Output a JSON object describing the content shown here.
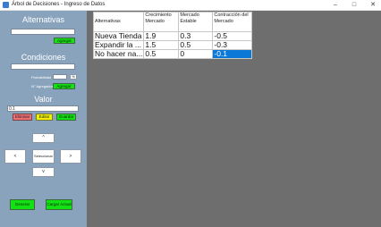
{
  "window": {
    "title": "Árbol de Decisiones - Ingreso de Datos",
    "minimize": "–",
    "maximize": "□",
    "close": "✕"
  },
  "sidebar": {
    "alternativas": {
      "title": "Alternativas",
      "input_value": "",
      "add_label": "Agregar"
    },
    "condiciones": {
      "title": "Condiciones",
      "input_value": "",
      "probabilidad_label": "Probabilidad",
      "probabilidad_value": "",
      "percent_label": "%",
      "agregar_label": "N° Agregados",
      "add_label": "Agregar"
    },
    "valor": {
      "title": "Valor",
      "input_value": "0.1",
      "eliminar_label": "Eliminar",
      "editar_label": "Editar",
      "guardar_label": "Guardar"
    },
    "nav": {
      "up": "^",
      "down": "v",
      "left": "<",
      "right": ">",
      "center": "Seleccionar"
    },
    "bottom": {
      "generar_label": "Generar",
      "cargar_label": "Cargar Actual"
    }
  },
  "table": {
    "headers": [
      "Alternativas",
      "Crecimiento Mercado",
      "Mercado Estable",
      "Contracción del Mercado"
    ],
    "rows": [
      [
        "Nueva Tienda",
        "1.9",
        "0.3",
        "-0.5"
      ],
      [
        "Expandir la ...",
        "1.5",
        "0.5",
        "-0.3"
      ],
      [
        "No hacer na...",
        "0.5",
        "0",
        "-0.1"
      ]
    ]
  },
  "colors": {
    "sidebar_bg": "#89a3bd",
    "grid_bg": "#6e6e6e",
    "green_button": "#13e113",
    "red_button": "#ee6f72",
    "yellow_button": "#f0f000",
    "selection": "#0a78d7"
  }
}
